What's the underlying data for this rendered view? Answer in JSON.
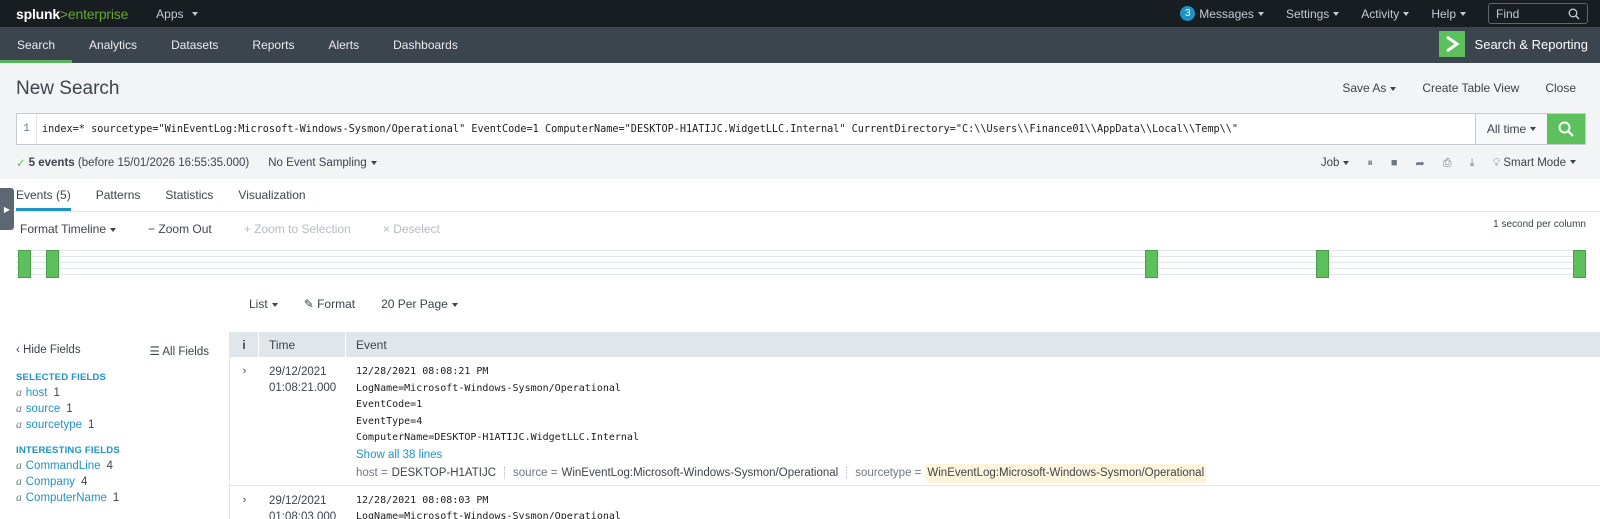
{
  "topbar": {
    "logo_splunk": "splunk",
    "logo_gt": ">",
    "logo_enterprise": "enterprise",
    "apps": "Apps",
    "messages_count": "3",
    "messages": "Messages",
    "settings": "Settings",
    "activity": "Activity",
    "help": "Help",
    "find_placeholder": "Find"
  },
  "appbar": {
    "nav": [
      "Search",
      "Analytics",
      "Datasets",
      "Reports",
      "Alerts",
      "Dashboards"
    ],
    "app_title": "Search & Reporting"
  },
  "search": {
    "page_title": "New Search",
    "save_as": "Save As",
    "create_table_view": "Create Table View",
    "close": "Close",
    "line_number": "1",
    "query": "index=* sourcetype=\"WinEventLog:Microsoft-Windows-Sysmon/Operational\" EventCode=1 ComputerName=\"DESKTOP-H1ATIJC.WidgetLLC.Internal\" CurrentDirectory=\"C:\\\\Users\\\\Finance01\\\\AppData\\\\Local\\\\Temp\\\\\"",
    "time_range": "All time",
    "events_count": "5 events",
    "events_before": "(before 15/01/2026 16:55:35.000)",
    "sampling": "No Event Sampling",
    "job": "Job",
    "mode": "Smart Mode"
  },
  "tabs": [
    "Events (5)",
    "Patterns",
    "Statistics",
    "Visualization"
  ],
  "timeline": {
    "format": "Format Timeline",
    "zoom_out": "Zoom Out",
    "zoom_selection": "Zoom to Selection",
    "deselect": "Deselect",
    "scale": "1 second per column",
    "accent": "#5cc05c"
  },
  "results_controls": {
    "list": "List",
    "format": "Format",
    "per_page": "20 Per Page"
  },
  "fields": {
    "hide": "Hide Fields",
    "all": "All Fields",
    "selected_head": "SELECTED FIELDS",
    "selected": [
      {
        "type": "a",
        "name": "host",
        "count": "1"
      },
      {
        "type": "a",
        "name": "source",
        "count": "1"
      },
      {
        "type": "a",
        "name": "sourcetype",
        "count": "1"
      }
    ],
    "interesting_head": "INTERESTING FIELDS",
    "interesting": [
      {
        "type": "a",
        "name": "CommandLine",
        "count": "4"
      },
      {
        "type": "a",
        "name": "Company",
        "count": "4"
      },
      {
        "type": "a",
        "name": "ComputerName",
        "count": "1"
      }
    ]
  },
  "events_table": {
    "col_i": "i",
    "col_time": "Time",
    "col_event": "Event",
    "rows": [
      {
        "date": "29/12/2021",
        "time": "01:08:21.000",
        "lines": [
          "12/28/2021 08:08:21 PM",
          "LogName=Microsoft-Windows-Sysmon/Operational",
          "EventCode=1",
          "EventType=4",
          "ComputerName=DESKTOP-H1ATIJC.WidgetLLC.Internal"
        ],
        "show_lines": "Show all 38 lines",
        "host_key": "host =",
        "host": "DESKTOP-H1ATIJC",
        "source_key": "source =",
        "source": "WinEventLog:Microsoft-Windows-Sysmon/Operational",
        "sourcetype_key": "sourcetype =",
        "sourcetype": "WinEventLog:Microsoft-Windows-Sysmon/Operational"
      },
      {
        "date": "29/12/2021",
        "time": "01:08:03.000",
        "lines": [
          "12/28/2021 08:08:03 PM",
          "LogName=Microsoft-Windows-Sysmon/Operational"
        ]
      }
    ]
  }
}
